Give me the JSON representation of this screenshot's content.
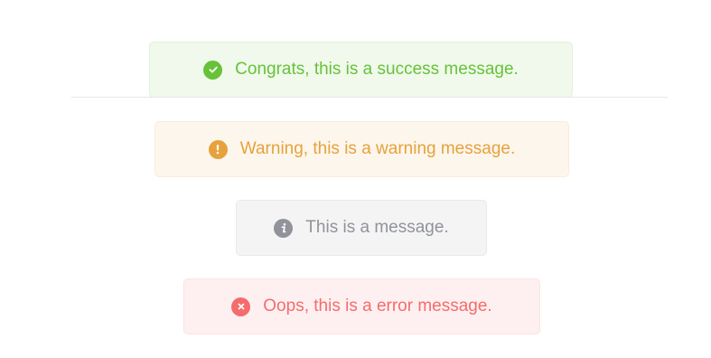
{
  "messages": {
    "success": {
      "text": "Congrats, this is a success message.",
      "icon": "check-circle-icon",
      "color": "#67c23a"
    },
    "warning": {
      "text": "Warning, this is a warning message.",
      "icon": "warning-circle-icon",
      "color": "#e6a23c"
    },
    "info": {
      "text": "This is a message.",
      "icon": "info-circle-icon",
      "color": "#909399"
    },
    "error": {
      "text": "Oops, this is a error message.",
      "icon": "close-circle-icon",
      "color": "#f56c6c"
    }
  }
}
